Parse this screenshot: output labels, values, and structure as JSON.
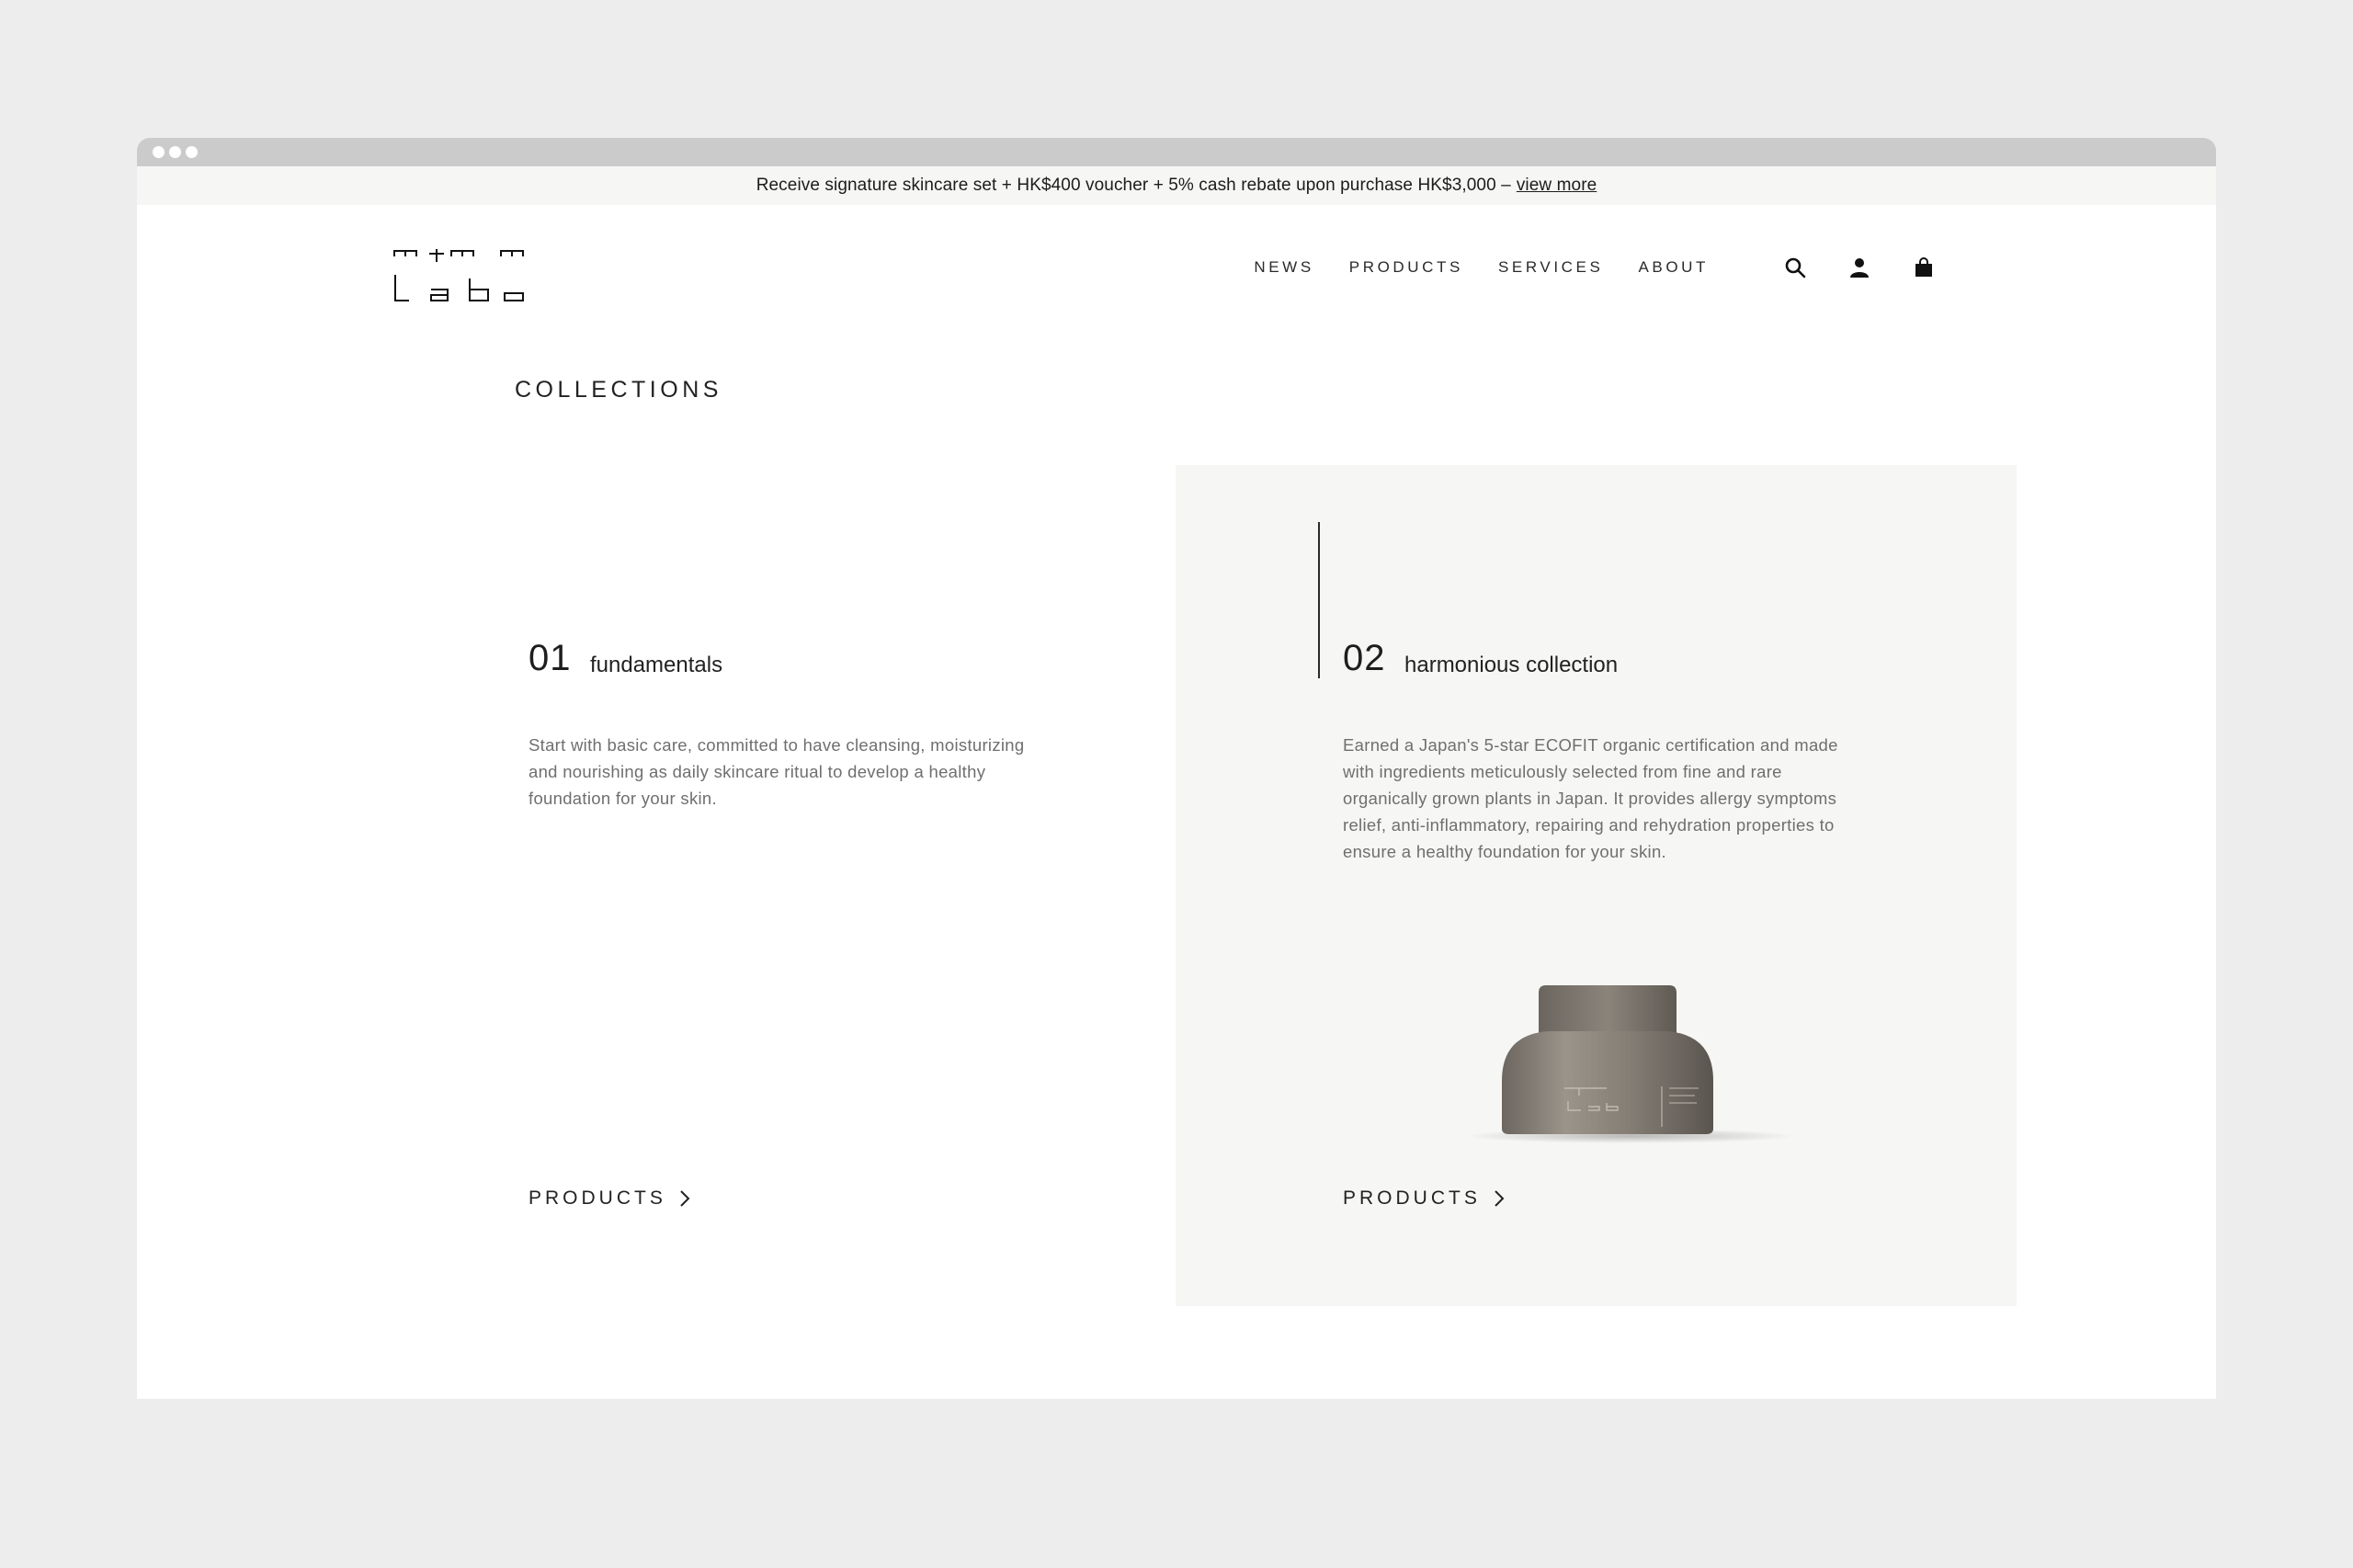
{
  "promo": {
    "text": "Receive signature skincare set + HK$400 voucher + 5% cash rebate upon purchase HK$3,000 –",
    "link": "view more"
  },
  "nav": {
    "items": [
      "NEWS",
      "PRODUCTS",
      "SERVICES",
      "ABOUT"
    ],
    "icons": [
      "search-icon",
      "account-icon",
      "cart-icon"
    ]
  },
  "page": {
    "section_title": "COLLECTIONS"
  },
  "collections": [
    {
      "number": "01",
      "title": "fundamentals",
      "description": "Start with basic care, committed to have cleansing, moisturizing and nourishing as daily skincare ritual to develop a healthy foundation for your skin.",
      "link": "PRODUCTS"
    },
    {
      "number": "02",
      "title": "harmonious collection",
      "description": "Earned a Japan's 5-star ECOFIT organic certification and made with ingredients meticulously selected from fine and rare organically grown plants in Japan. It provides allergy symptoms relief, anti-inflammatory, repairing and rehydration properties to ensure a healthy foundation for your skin.",
      "link": "PRODUCTS"
    }
  ],
  "colors": {
    "background": "#ededed",
    "chrome": "#cbcbcb",
    "promo_bg": "#f6f6f4",
    "card_bg": "#f6f6f4",
    "text": "#222222",
    "muted": "#6f6f6f"
  }
}
